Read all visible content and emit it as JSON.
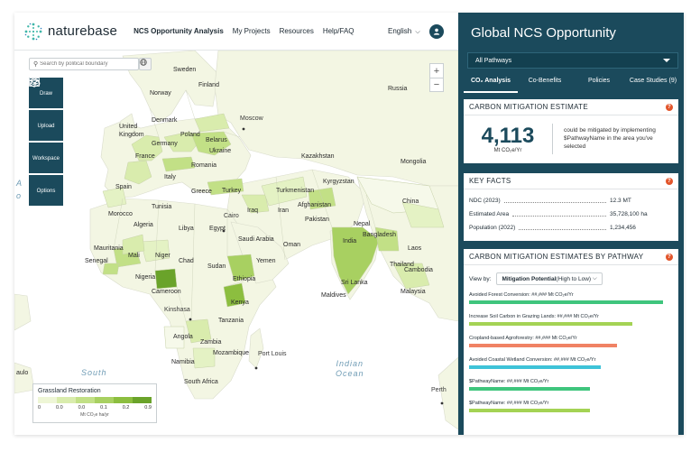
{
  "header": {
    "logo_text": "naturebase",
    "nav": [
      "NCS Opportunity Analysis",
      "My Projects",
      "Resources",
      "Help/FAQ"
    ],
    "language": "English",
    "colors": {
      "brand": "#1b4a5c"
    }
  },
  "map": {
    "search_placeholder": "Search by political boundary",
    "tools": [
      {
        "label": "Draw",
        "icon": "cloud-upload-icon"
      },
      {
        "label": "Upload",
        "icon": "cloud-upload-icon"
      },
      {
        "label": "Workspace",
        "icon": "window-icon"
      },
      {
        "label": "Options",
        "icon": "layers-icon"
      }
    ],
    "zoom_in": "+",
    "zoom_out": "−",
    "labels": {
      "sweden": "Sweden",
      "finland": "Finland",
      "norway": "Norway",
      "russia": "Russia",
      "moscow": "Moscow",
      "denmark": "Denmark",
      "united_kingdom": "United\nKingdom",
      "poland": "Poland",
      "germany": "Germany",
      "belarus": "Belarus",
      "ukraine": "Ukraine",
      "france": "France",
      "romania": "Romania",
      "kazakhstan": "Kazakhstan",
      "mongolia": "Mongolia",
      "spain": "Spain",
      "italy": "Italy",
      "greece": "Greece",
      "turkey": "Turkey",
      "turkmenistan": "Turkmenistan",
      "kyrgyzstan": "Kyrgyzstan",
      "china": "China",
      "morocco": "Morocco",
      "tunisia": "Tunisia",
      "cairo": "Cairo",
      "iraq": "Iraq",
      "iran": "Iran",
      "afghanistan": "Afghanistan",
      "pakistan": "Pakistan",
      "algeria": "Algeria",
      "libya": "Libya",
      "egypt": "Egypt",
      "saudi_arabia": "Saudi Arabia",
      "oman": "Oman",
      "nepal": "Nepal",
      "india": "India",
      "bangladesh": "Bangladesh",
      "laos": "Laos",
      "mauritania": "Mauritania",
      "mali": "Mali",
      "niger": "Niger",
      "chad": "Chad",
      "sudan": "Sudan",
      "yemen": "Yemen",
      "senegal": "Senegal",
      "thailand": "Thailand",
      "cambodia": "Cambodia",
      "nigeria": "Nigeria",
      "ethiopia": "Ethiopia",
      "sri_lanka": "Sri Lanka",
      "cameroon": "Cameroon",
      "maldives": "Maldives",
      "malaysia": "Malaysia",
      "kenya": "Kenya",
      "kinshasa": "Kinshasa",
      "tanzania": "Tanzania",
      "angola": "Angola",
      "zambia": "Zambia",
      "mozambique": "Mozambique",
      "namibia": "Namibia",
      "port_louis": "Port Louis",
      "south_africa": "South Africa",
      "perth": "Perth",
      "aulo": "aulo",
      "a_letter": "A",
      "o_letter": "o"
    },
    "oceans": {
      "south_atlantic": "South",
      "indian_ocean": "Indian\nOcean"
    },
    "legend": {
      "title": "Grassland Restoration",
      "ticks": [
        "0",
        "0.0",
        "0.0",
        "0.1",
        "0.2",
        "0.9"
      ],
      "colors": [
        "#eef6d6",
        "#d9ecad",
        "#c2e086",
        "#a8d061",
        "#8cbe3f",
        "#6aa32a"
      ],
      "unit": "Mt CO₂e ha/yr"
    }
  },
  "panel": {
    "title": "Global NCS Opportunity",
    "pathway_select": "All Pathways",
    "tabs": [
      "CO₂ Analysis",
      "Co-Benefits",
      "Policies",
      "Case Studies (9)"
    ],
    "estimate": {
      "heading": "CARBON MITIGATION ESTIMATE",
      "value": "4,113",
      "unit": "Mt CO₂e/Yr",
      "description": "could be mitigated by implementing $PathwayName in the area you've selected"
    },
    "key_facts": {
      "heading": "KEY FACTS",
      "rows": [
        {
          "label": "NDC (2023)",
          "value": "12.3 MT"
        },
        {
          "label": "Estimated Area",
          "value": "35,728,100 ha"
        },
        {
          "label": "Population (2022)",
          "value": "1,234,456"
        }
      ]
    },
    "pathways": {
      "heading": "CARBON MITIGATION ESTIMATES BY PATHWAY",
      "view_by_label": "View by:",
      "view_by_bold": "Mitigation Potential",
      "view_by_rest": " (High to Low)",
      "rows": [
        {
          "label": "Avoided Forest Conversion: ##,### Mt CO₂e/Yr",
          "value": 0.96,
          "color": "#3fc57d"
        },
        {
          "label": "Increase Soil Carbon in Grazing Lands: ##,### Mt CO₂e/Yr",
          "value": 0.81,
          "color": "#a4d354"
        },
        {
          "label": "Cropland-based Agroforestry: ##,### Mt CO₂e/Yr",
          "value": 0.73,
          "color": "#f08264"
        },
        {
          "label": "Avoided Coastal Wetland Conversion: ##,### Mt CO₂e/Yr",
          "value": 0.65,
          "color": "#3ec3d8"
        },
        {
          "label": "$PathwayName: ##,### Mt CO₂e/Yr",
          "value": 0.6,
          "color": "#3fc57d"
        },
        {
          "label": "$PathwayName: ##,### Mt CO₂e/Yr",
          "value": 0.6,
          "color": "#a4d354"
        }
      ]
    }
  }
}
